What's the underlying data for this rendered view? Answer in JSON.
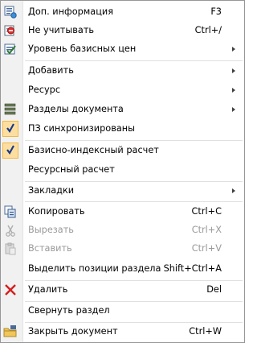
{
  "menu": {
    "items": [
      {
        "label": "Доп. информация",
        "shortcut": "F3",
        "icon": "info-list-icon"
      },
      {
        "label": "Не учитывать",
        "shortcut": "Ctrl+/",
        "icon": "exclude-icon"
      },
      {
        "label": "Уровень базисных цен",
        "submenu": true,
        "icon": "price-level-icon"
      },
      {
        "label": "Добавить",
        "submenu": true
      },
      {
        "label": "Ресурс",
        "submenu": true
      },
      {
        "label": "Разделы документа",
        "submenu": true,
        "icon": "sections-icon"
      },
      {
        "label": "ПЗ синхронизированы",
        "checked": true,
        "icon": "check-icon"
      },
      {
        "label": "Базисно-индексный расчет",
        "checked": true,
        "icon": "check-icon"
      },
      {
        "label": "Ресурсный расчет"
      },
      {
        "label": "Закладки",
        "submenu": true
      },
      {
        "label": "Копировать",
        "shortcut": "Ctrl+C",
        "icon": "copy-icon"
      },
      {
        "label": "Вырезать",
        "shortcut": "Ctrl+X",
        "disabled": true,
        "icon": "cut-icon"
      },
      {
        "label": "Вставить",
        "shortcut": "Ctrl+V",
        "disabled": true,
        "icon": "paste-icon"
      },
      {
        "label": "Выделить позиции раздела",
        "shortcut": "Shift+Ctrl+A"
      },
      {
        "label": "Удалить",
        "shortcut": "Del",
        "icon": "delete-icon"
      },
      {
        "label": "Свернуть раздел"
      },
      {
        "label": "Закрыть документ",
        "shortcut": "Ctrl+W",
        "icon": "close-folder-icon"
      }
    ]
  },
  "colors": {
    "menu_border": "#979797",
    "gutter": "#f1f1f1",
    "check_bg": "#fcdfa0",
    "check_border": "#f0b845",
    "disabled_text": "#9a9a9a",
    "delete_red": "#d42020"
  }
}
